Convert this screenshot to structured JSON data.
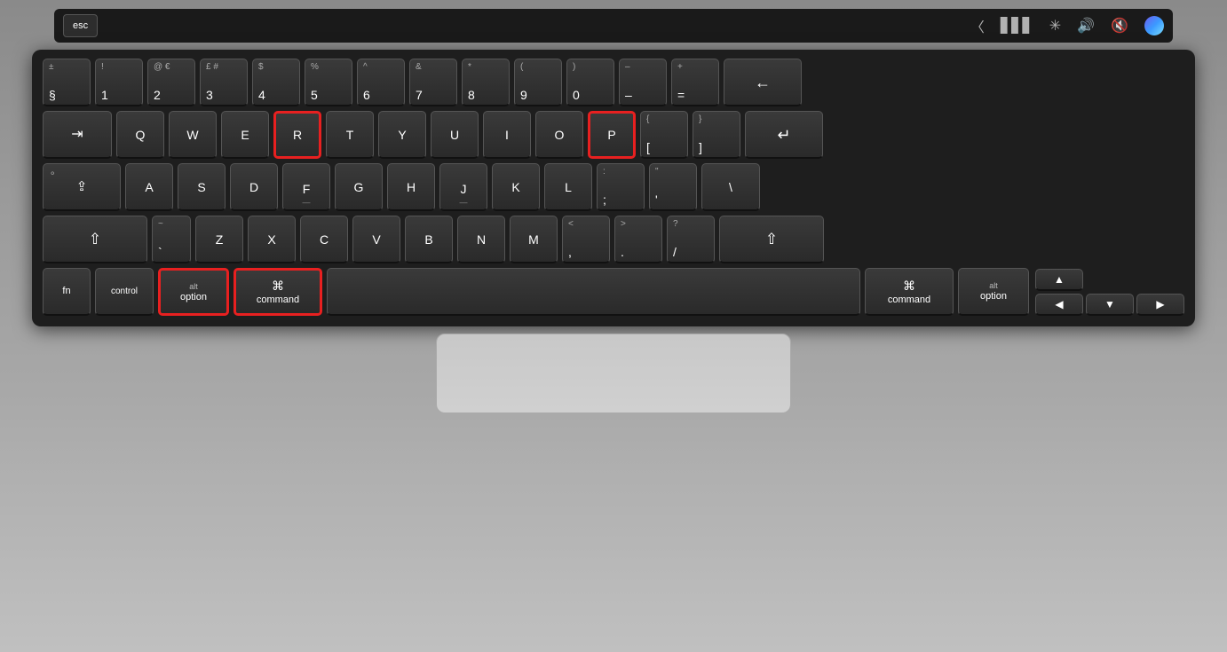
{
  "keyboard": {
    "touchbar": {
      "esc_label": "esc",
      "icons": [
        "⟨",
        "▋",
        "✳",
        "🔊",
        "🔇",
        "◉"
      ]
    },
    "rows": {
      "row1": {
        "keys": [
          {
            "id": "plus-minus",
            "top": "±",
            "main": "§",
            "w": "1u"
          },
          {
            "id": "1",
            "top": "!",
            "main": "1",
            "w": "1u"
          },
          {
            "id": "2",
            "top": "@€",
            "main": "2",
            "w": "1u"
          },
          {
            "id": "3",
            "top": "£#",
            "main": "3",
            "w": "1u"
          },
          {
            "id": "4",
            "top": "$",
            "main": "4",
            "w": "1u"
          },
          {
            "id": "5",
            "top": "%",
            "main": "5",
            "w": "1u"
          },
          {
            "id": "6",
            "top": "^",
            "main": "6",
            "w": "1u"
          },
          {
            "id": "7",
            "top": "&",
            "main": "7",
            "w": "1u"
          },
          {
            "id": "8",
            "top": "*",
            "main": "8",
            "w": "1u"
          },
          {
            "id": "9",
            "top": "(",
            "main": "9",
            "w": "1u"
          },
          {
            "id": "0",
            "top": ")",
            "main": "0",
            "w": "1u"
          },
          {
            "id": "minus",
            "top": "–",
            "main": "–",
            "w": "1u"
          },
          {
            "id": "equals",
            "top": "+",
            "main": "=",
            "w": "1u"
          },
          {
            "id": "delete",
            "top": "",
            "main": "←",
            "w": "delete",
            "centered": true
          }
        ]
      },
      "row2": {
        "keys": [
          {
            "id": "tab",
            "main": "⇥",
            "w": "tab",
            "centered": true
          },
          {
            "id": "q",
            "main": "Q",
            "w": "1u"
          },
          {
            "id": "w",
            "main": "W",
            "w": "1u"
          },
          {
            "id": "e",
            "main": "E",
            "w": "1u"
          },
          {
            "id": "r",
            "main": "R",
            "w": "1u",
            "highlight": true
          },
          {
            "id": "t",
            "main": "T",
            "w": "1u"
          },
          {
            "id": "y",
            "main": "Y",
            "w": "1u"
          },
          {
            "id": "u",
            "main": "U",
            "w": "1u"
          },
          {
            "id": "i",
            "main": "I",
            "w": "1u"
          },
          {
            "id": "o",
            "main": "O",
            "w": "1u"
          },
          {
            "id": "p",
            "main": "P",
            "w": "1u",
            "highlight": true
          },
          {
            "id": "openbracket",
            "top": "{",
            "main": "[",
            "w": "1u"
          },
          {
            "id": "closebracket",
            "top": "}",
            "main": "]",
            "w": "1u"
          },
          {
            "id": "return",
            "main": "↵",
            "w": "return",
            "centered": true
          }
        ]
      },
      "row3": {
        "keys": [
          {
            "id": "caps",
            "main": "⇪",
            "w": "caps",
            "centered": true
          },
          {
            "id": "a",
            "main": "A",
            "w": "1u"
          },
          {
            "id": "s",
            "main": "S",
            "w": "1u"
          },
          {
            "id": "d",
            "main": "D",
            "w": "1u"
          },
          {
            "id": "f",
            "main": "F",
            "w": "1u",
            "sub": "—"
          },
          {
            "id": "g",
            "main": "G",
            "w": "1u"
          },
          {
            "id": "h",
            "main": "H",
            "w": "1u"
          },
          {
            "id": "j",
            "main": "J",
            "w": "1u",
            "sub": "—"
          },
          {
            "id": "k",
            "main": "K",
            "w": "1u"
          },
          {
            "id": "l",
            "main": "L",
            "w": "1u"
          },
          {
            "id": "semicolon",
            "top": ":",
            "main": ";",
            "w": "1u"
          },
          {
            "id": "quote",
            "top": "\"",
            "main": "'",
            "w": "1u"
          },
          {
            "id": "backslash",
            "top": "",
            "main": "\\",
            "w": "backslash"
          }
        ]
      },
      "row4": {
        "keys": [
          {
            "id": "shift-l",
            "main": "⇧",
            "w": "shift-l",
            "centered": true
          },
          {
            "id": "backtick",
            "top": "~",
            "main": "`",
            "w": "backtick"
          },
          {
            "id": "z",
            "main": "Z",
            "w": "1u"
          },
          {
            "id": "x",
            "main": "X",
            "w": "1u"
          },
          {
            "id": "c",
            "main": "C",
            "w": "1u"
          },
          {
            "id": "v",
            "main": "V",
            "w": "1u"
          },
          {
            "id": "b",
            "main": "B",
            "w": "1u"
          },
          {
            "id": "n",
            "main": "N",
            "w": "1u"
          },
          {
            "id": "m",
            "main": "M",
            "w": "1u"
          },
          {
            "id": "comma",
            "top": "<",
            "main": ",",
            "w": "1u"
          },
          {
            "id": "period",
            "top": ">",
            "main": ".",
            "w": "1u"
          },
          {
            "id": "slash",
            "top": "?",
            "main": "/",
            "w": "1u"
          },
          {
            "id": "shift-r",
            "main": "⇧",
            "w": "shift-r",
            "centered": true
          }
        ]
      },
      "row5": {
        "keys": [
          {
            "id": "fn",
            "main": "fn",
            "w": "fn",
            "centered": true
          },
          {
            "id": "ctrl",
            "main": "control",
            "w": "ctrl",
            "centered": true,
            "small": true
          },
          {
            "id": "opt-l",
            "top": "alt",
            "main": "option",
            "w": "opt",
            "highlight": true,
            "small": true
          },
          {
            "id": "cmd-l",
            "top": "⌘",
            "main": "command",
            "w": "cmd",
            "highlight": true,
            "small": true
          },
          {
            "id": "space",
            "main": "",
            "w": "space"
          },
          {
            "id": "cmd-r",
            "top": "⌘",
            "main": "command",
            "w": "cmd",
            "small": true
          },
          {
            "id": "opt-r",
            "top": "alt",
            "main": "option",
            "w": "opt",
            "small": true
          },
          {
            "id": "arr-left",
            "main": "◀",
            "w": "1u",
            "centered": true
          },
          {
            "id": "arr-updown",
            "main": "",
            "w": "1u",
            "arrows": true
          }
        ]
      }
    }
  }
}
